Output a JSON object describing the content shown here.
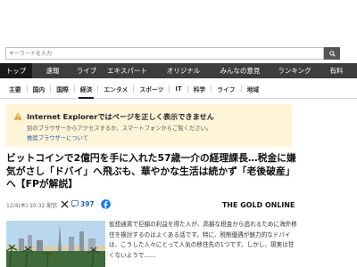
{
  "search": {
    "placeholder": "キーワードを入力"
  },
  "nav_main": [
    {
      "label": "トップ",
      "active": true
    },
    {
      "label": "速報",
      "active": false
    },
    {
      "label": "ライブ",
      "active": false
    },
    {
      "label": "エキスパート",
      "active": false
    },
    {
      "label": "オリジナル",
      "active": false
    },
    {
      "label": "みんなの意見",
      "active": false
    },
    {
      "label": "ランキング",
      "active": false
    },
    {
      "label": "有料",
      "active": false
    }
  ],
  "nav_sub": [
    {
      "label": "主要",
      "active": false
    },
    {
      "label": "国内",
      "active": false
    },
    {
      "label": "国際",
      "active": false
    },
    {
      "label": "経済",
      "active": true
    },
    {
      "label": "エンタメ",
      "active": false
    },
    {
      "label": "スポーツ",
      "active": false
    },
    {
      "label": "IT",
      "active": false
    },
    {
      "label": "科学",
      "active": false
    },
    {
      "label": "ライフ",
      "active": false
    },
    {
      "label": "地域",
      "active": false
    }
  ],
  "ie_notice": {
    "title": "Internet Explorerではページを正しく表示できません",
    "description": "別のブラウザーからアクセスするか、スマートフォンからご覧ください。",
    "link": "推奨ブラウザーについて",
    "bg_color": "#fff4d8"
  },
  "article": {
    "headline": "ビットコインで2億円を手に入れた57歳一介の経理課長…税金に嫌気がさし「ドバイ」へ飛ぶも、華やかな生活は続かず「老後破産」へ【FPが解説】",
    "date": "12/4(木) 10:32 配信",
    "comment_count": "397",
    "source": "THE GOLD ONLINE",
    "body": "仮想通貨で巨額の利益を得た人が、高額な税金から逃れるために海外移住を検討するのはよくある話です。特に、税制優遇が魅力的なドバイは、こうした人々にとって人気の移住先の1つです。しかし、現実は甘くないようで……"
  },
  "colors": {
    "nav_bg": "#3d3d3d",
    "nav_active": "#1a1a1a",
    "link": "#2b5fa8"
  }
}
